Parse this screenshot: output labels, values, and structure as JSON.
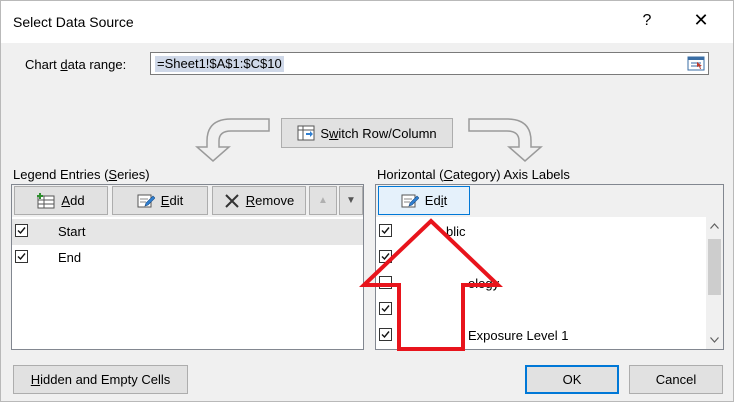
{
  "window": {
    "title": "Select Data Source",
    "help_glyph": "?",
    "close_glyph": "✕"
  },
  "range": {
    "label_pre": "Chart ",
    "label_underlined": "d",
    "label_post": "ata range:",
    "value": "=Sheet1!$A$1:$C$10"
  },
  "switch": {
    "label_underlined": "w",
    "label_pre": "S",
    "label_post": "itch Row/Column"
  },
  "legend": {
    "heading_pre": "Legend Entries (",
    "heading_underlined": "S",
    "heading_post": "eries)",
    "add": {
      "u": "A",
      "rest": "dd"
    },
    "edit": {
      "u": "E",
      "rest": "dit"
    },
    "remove": {
      "u": "R",
      "rest": "emove"
    },
    "move_up_glyph": "▲",
    "move_down_glyph": "▼",
    "items": [
      {
        "label": "Start",
        "checked": true
      },
      {
        "label": "End",
        "checked": true
      }
    ]
  },
  "axis": {
    "heading_pre": "Horizontal (",
    "heading_underlined": "C",
    "heading_post": "ategory) Axis Labels",
    "edit": {
      "pre": "Ed",
      "u": "i",
      "rest": "t"
    },
    "items": [
      {
        "label": "blic",
        "checked": true
      },
      {
        "label": "",
        "checked": true
      },
      {
        "label": "ology",
        "checked": false
      },
      {
        "label": "",
        "checked": true
      },
      {
        "label": "Exposure Level 1",
        "checked": true
      }
    ]
  },
  "footer": {
    "hidden": {
      "u": "H",
      "rest": "idden and Empty Cells"
    },
    "ok": "OK",
    "cancel": "Cancel"
  },
  "colors": {
    "annotation_arrow": "#e8141c",
    "selection_highlight": "#cfd8e8",
    "focus_border": "#0078d7"
  },
  "icons": {
    "help": "question-mark",
    "close": "x-close",
    "collapse": "range-collapse-icon",
    "switch": "switch-row-column-icon",
    "add": "add-series-icon",
    "edit": "edit-pencil-icon",
    "remove": "remove-x-icon"
  }
}
